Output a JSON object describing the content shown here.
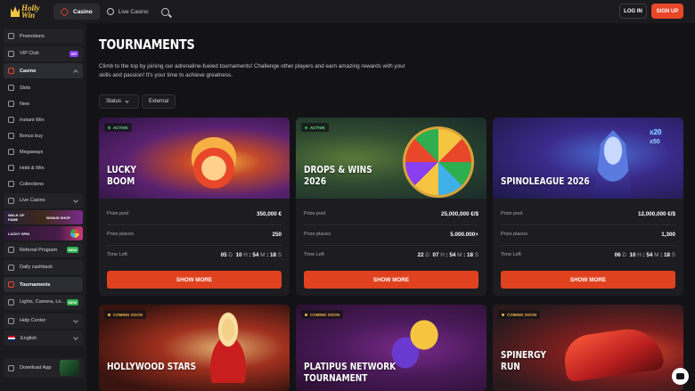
{
  "brand": {
    "line1": "Holly",
    "line2": "Win"
  },
  "header": {
    "tabs": [
      {
        "label": "Casino"
      },
      {
        "label": "Live Casino"
      }
    ],
    "login": "LOG IN",
    "signup": "SIGN UP"
  },
  "sidebar": {
    "promotions": "Promotions",
    "vip": "VIP Club",
    "vip_badge": "VIP",
    "casino": "Casino",
    "casino_sub": [
      "Slots",
      "New",
      "Instant Win",
      "Bonus buy",
      "Megaways",
      "Hold & Win",
      "Collections"
    ],
    "live_casino": "Live Casino",
    "walk_of_fame": "WALK OF FAME",
    "bonus_shop": "BONUS SHOP",
    "lucky_spin": "LUCKY SPIN",
    "referral": "Referral Program",
    "new_badge": "NEW",
    "daily_cashback": "Daily cashback",
    "tournaments": "Tournaments",
    "lights": "Lights, Camera, Lo...",
    "help": "Help Center",
    "language": "English",
    "download": "Download App"
  },
  "page": {
    "title": "TOURNAMENTS",
    "intro": "Climb to the top by joining our adrenaline-fueled tournaments! Challenge other players and earn amazing rewards with your skills and passion! It's your time to achieve greatness.",
    "filters": {
      "status": "Status",
      "external": "External"
    }
  },
  "labels": {
    "prize_pool": "Prize pool",
    "prize_places": "Prize places",
    "time_left": "Time Left",
    "show_more": "SHOW MORE",
    "d": "D",
    "h": "H",
    "m": "M",
    "s": "S"
  },
  "tournaments": [
    {
      "status": "ACTIVE",
      "name_l1": "LUCKY",
      "name_l2": "BOOM",
      "prize_pool": "350,000 €",
      "prize_places": "250",
      "days": "05",
      "hours": "10",
      "minutes": "54",
      "seconds": "18"
    },
    {
      "status": "ACTIVE",
      "name_l1": "DROPS & WINS",
      "name_l2": "2026",
      "prize_pool": "25,000,000 €/$",
      "prize_places": "5.000.000+",
      "days": "22",
      "hours": "07",
      "minutes": "54",
      "seconds": "18"
    },
    {
      "status": "",
      "name_l1": "SPINOLEAGUE 2026",
      "name_l2": "",
      "prize_pool": "12,000,000 €/$",
      "prize_places": "1,300",
      "days": "06",
      "hours": "10",
      "minutes": "54",
      "seconds": "18",
      "multipliers": [
        "x20",
        "x50"
      ]
    },
    {
      "status": "COMING SOON",
      "name_l1": "HOLLYWOOD STARS",
      "name_l2": ""
    },
    {
      "status": "COMING SOON",
      "name_l1": "PLATIPUS NETWORK TOURNAMENT",
      "name_l2": ""
    },
    {
      "status": "COMING SOON",
      "name_l1": "SPINERGY",
      "name_l2": "RUN"
    }
  ],
  "colors": {
    "accent": "#e8472a",
    "active": "#2fae4f",
    "soon": "#f5b342",
    "bg": "#131316",
    "panel": "#1b1b1f"
  }
}
